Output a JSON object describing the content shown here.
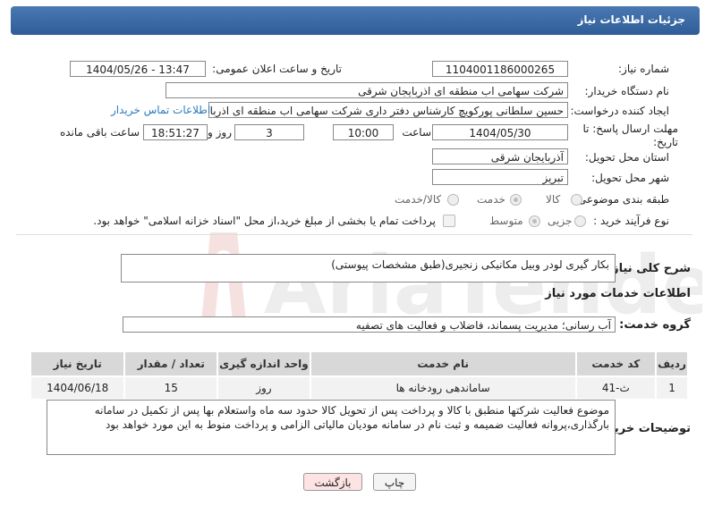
{
  "header": {
    "title": "جزئیات اطلاعات نیاز"
  },
  "form": {
    "need_number_label": "شماره نیاز:",
    "need_number": "1104001186000265",
    "announce_label": "تاریخ و ساعت اعلان عمومی:",
    "announce_value": "1404/05/26 - 13:47",
    "buyer_label": "نام دستگاه خریدار:",
    "buyer_value": "شرکت سهامی اب منطقه ای اذربایجان شرقی",
    "requester_label": "ایجاد کننده درخواست:",
    "requester_value": "حسین سلطانی پورکویچ کارشناس دفتر داری شرکت سهامی اب منطقه ای اذربا",
    "contact_link": "اطلاعات تماس خریدار",
    "deadline_label_1": "مهلت ارسال پاسخ: تا",
    "deadline_label_2": "تاریخ:",
    "deadline_date": "1404/05/30",
    "time_label": "ساعت",
    "deadline_time": "10:00",
    "days_value": "3",
    "days_label": "روز و",
    "remaining_time": "18:51:27",
    "remaining_label": "ساعت باقی مانده",
    "province_label": "استان محل تحویل:",
    "province_value": "آذربایجان شرقی",
    "city_label": "شهر محل تحویل:",
    "city_value": "تبریز",
    "category_label": "طبقه بندی موضوعی:",
    "category_options": [
      "کالا",
      "خدمت",
      "کالا/خدمت"
    ],
    "process_label": "نوع فرآیند خرید :",
    "process_options": [
      "جزیی",
      "متوسط"
    ],
    "payment_note": "پرداخت تمام یا بخشی از مبلغ خرید،از محل \"اسناد خزانه اسلامی\" خواهد بود."
  },
  "description": {
    "label": "شرح کلی نیاز:",
    "value": "بکار گیری لودر وبیل مکانیکی زنجیری(طبق مشخصات پیوستی)"
  },
  "services": {
    "section_title": "اطلاعات خدمات مورد نیاز",
    "group_label": "گروه خدمت:",
    "group_value": "آب رسانی؛ مدیریت پسماند، فاضلاب و فعالیت های تصفیه",
    "columns": [
      "ردیف",
      "کد خدمت",
      "نام خدمت",
      "واحد اندازه گیری",
      "تعداد / مقدار",
      "تاریخ نیاز"
    ],
    "rows": [
      {
        "row": "1",
        "code": "ث-41",
        "name": "ساماندهی رودخانه ها",
        "unit": "روز",
        "qty": "15",
        "date": "1404/06/18"
      }
    ]
  },
  "buyer_notes": {
    "label": "توضیحات خریدار:",
    "value": "موضوع فعالیت شرکتها منطبق با کالا و پرداخت پس از تحویل کالا حدود سه  ماه واستعلام بها پس از تکمیل در سامانه بارگذاری،پروانه فعالیت ضمیمه و ثبت نام در سامانه مودیان مالیاتی الزامی و پرداخت منوط به این مورد خواهد بود"
  },
  "buttons": {
    "print": "چاپ",
    "back": "بازگشت"
  },
  "colors": {
    "header": "#3a69a6",
    "link": "#2b7bbf",
    "back_button": "#fde3e3"
  }
}
